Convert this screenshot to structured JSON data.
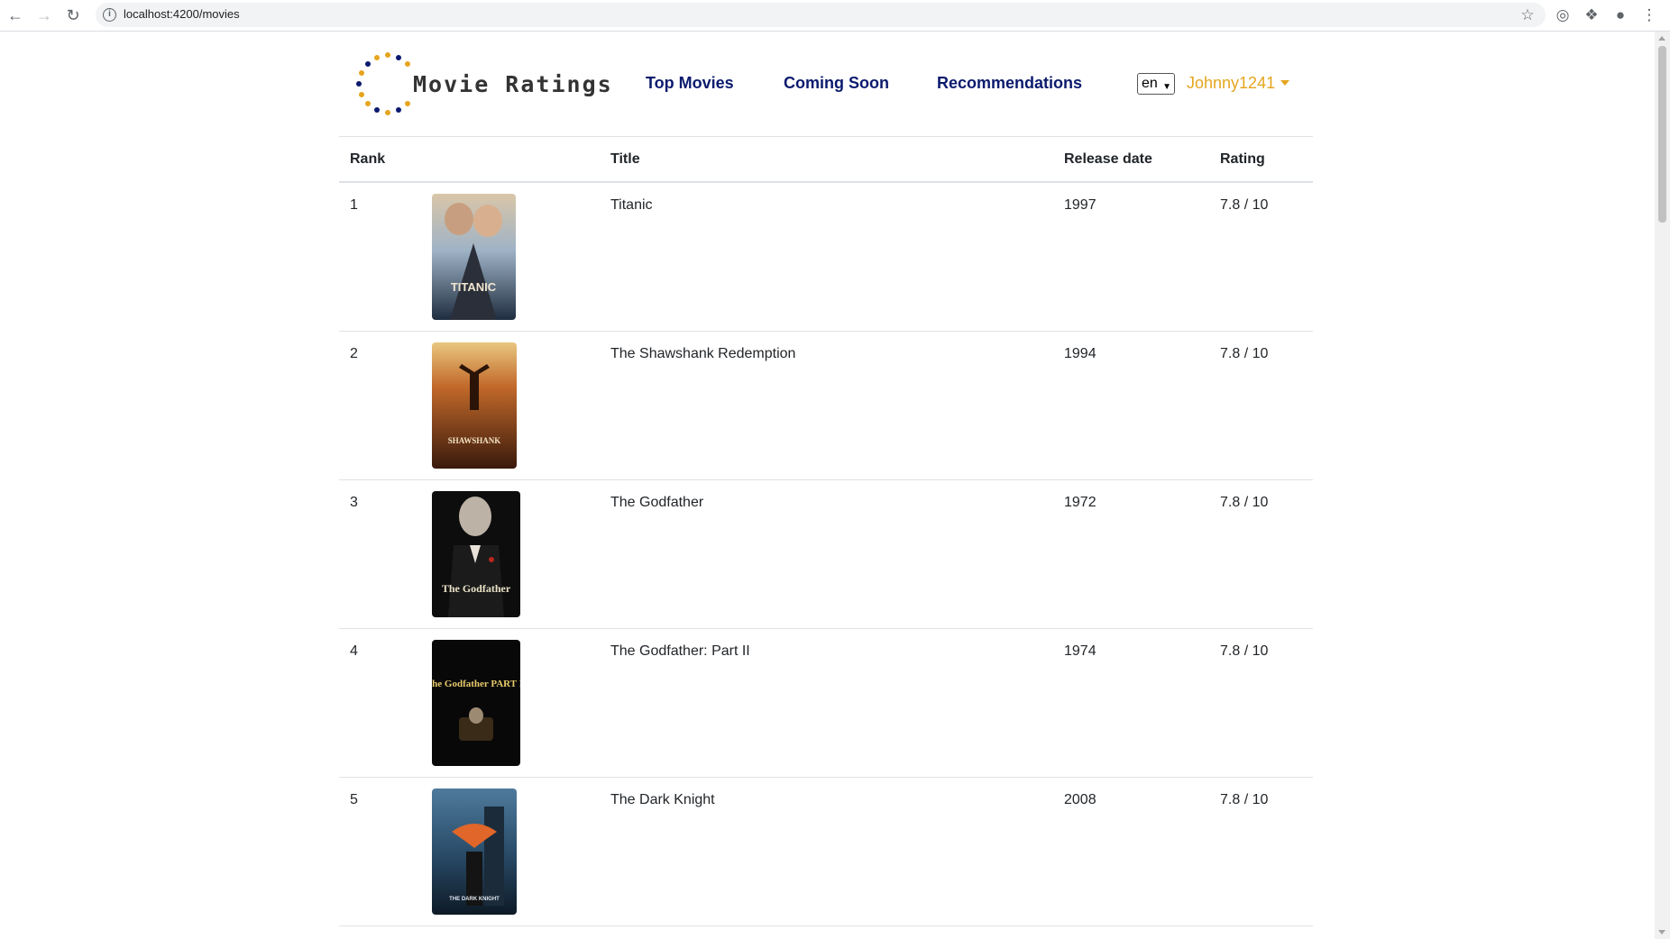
{
  "browser": {
    "url": "localhost:4200/movies"
  },
  "header": {
    "brand": "Movie Ratings",
    "nav": [
      "Top Movies",
      "Coming Soon",
      "Recommendations"
    ],
    "language": "en",
    "user": "Johnny1241"
  },
  "table": {
    "columns": {
      "rank": "Rank",
      "title": "Title",
      "release": "Release date",
      "rating": "Rating"
    },
    "rows": [
      {
        "rank": "1",
        "title": "Titanic",
        "year": "1997",
        "rating": "7.8 / 10",
        "poster_text": "TITANIC"
      },
      {
        "rank": "2",
        "title": "The Shawshank Redemption",
        "year": "1994",
        "rating": "7.8 / 10",
        "poster_text": "SHAWSHANK"
      },
      {
        "rank": "3",
        "title": "The Godfather",
        "year": "1972",
        "rating": "7.8 / 10",
        "poster_text": "The Godfather"
      },
      {
        "rank": "4",
        "title": "The Godfather: Part II",
        "year": "1974",
        "rating": "7.8 / 10",
        "poster_text": "The Godfather PART II"
      },
      {
        "rank": "5",
        "title": "The Dark Knight",
        "year": "2008",
        "rating": "7.8 / 10",
        "poster_text": "THE DARK KNIGHT"
      }
    ]
  }
}
